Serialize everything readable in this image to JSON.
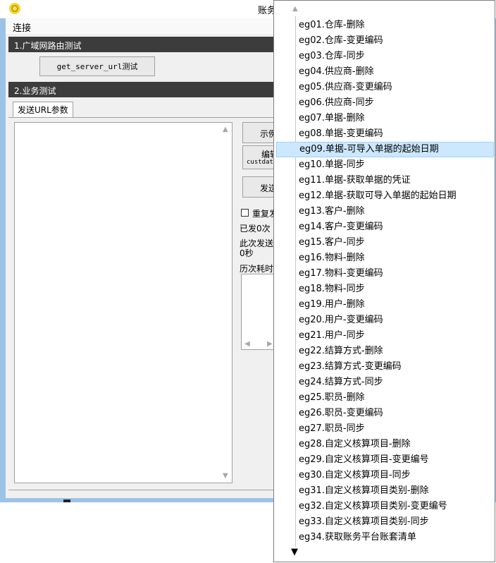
{
  "window": {
    "title": "账务"
  },
  "menu": {
    "connect": "连接"
  },
  "section1": {
    "title": "1.广域网路由测试",
    "button": "get_server_url测试"
  },
  "section2": {
    "title": "2.业务测试",
    "tab": "发送URL参数",
    "example_button": "示例",
    "edit_button_line1": "编辑",
    "edit_button_line2": "custdat",
    "send_button": "发送",
    "repeat_label": "重复发",
    "sent_count": "已发0次",
    "this_send_label": "此次发送",
    "this_send_value": "0秒",
    "history_label": "历次耗时"
  },
  "dropdown": {
    "selected_index": 8,
    "items": [
      "eg01.仓库-删除",
      "eg02.仓库-变更编码",
      "eg03.仓库-同步",
      "eg04.供应商-删除",
      "eg05.供应商-变更编码",
      "eg06.供应商-同步",
      "eg07.单据-删除",
      "eg08.单据-变更编码",
      "eg09.单据-可导入单据的起始日期",
      "eg10.单据-同步",
      "eg11.单据-获取单据的凭证",
      "eg12.单据-获取可导入单据的起始日期",
      "eg13.客户-删除",
      "eg14.客户-变更编码",
      "eg15.客户-同步",
      "eg16.物料-删除",
      "eg17.物料-变更编码",
      "eg18.物料-同步",
      "eg19.用户-删除",
      "eg20.用户-变更编码",
      "eg21.用户-同步",
      "eg22.结算方式-删除",
      "eg23.结算方式-变更编码",
      "eg24.结算方式-同步",
      "eg25.职员-删除",
      "eg26.职员-变更编码",
      "eg27.职员-同步",
      "eg28.自定义核算项目-删除",
      "eg29.自定义核算项目-变更编号",
      "eg30.自定义核算项目-同步",
      "eg31.自定义核算项目类别-删除",
      "eg32.自定义核算项目类别-变更编号",
      "eg33.自定义核算项目类别-同步",
      "eg34.获取账务平台账套清单"
    ]
  }
}
